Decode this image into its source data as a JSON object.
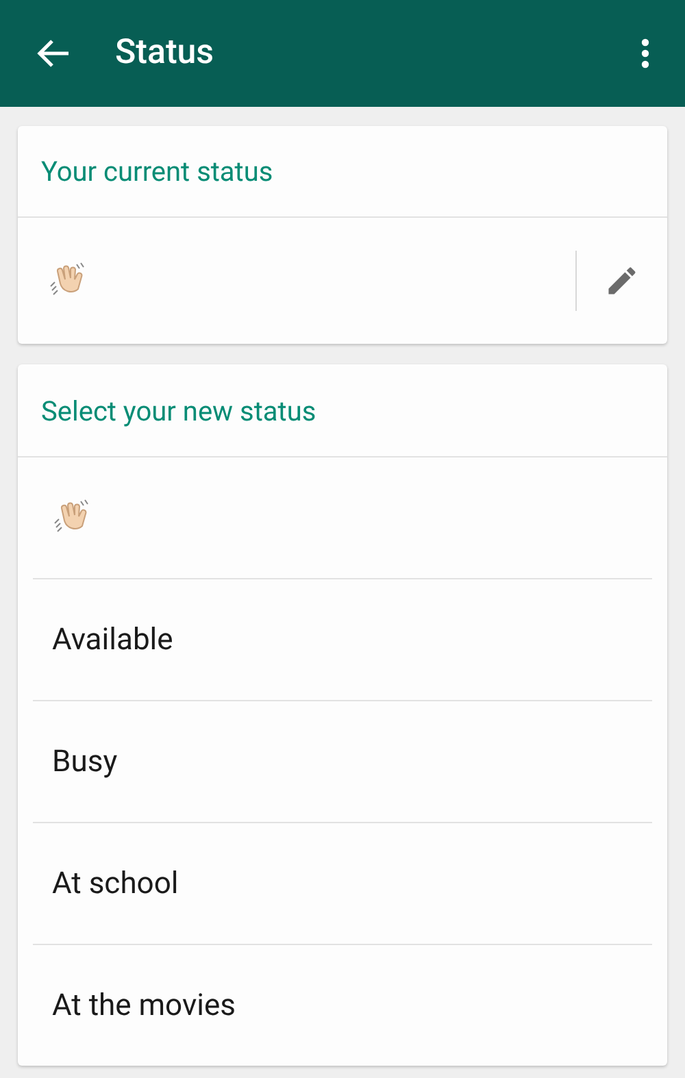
{
  "app_bar": {
    "title": "Status"
  },
  "current_status": {
    "heading": "Your current status",
    "value": {
      "kind": "wave"
    }
  },
  "new_status": {
    "heading": "Select your new status",
    "options": [
      {
        "kind": "wave"
      },
      {
        "kind": "text",
        "label": "Available"
      },
      {
        "kind": "text",
        "label": "Busy"
      },
      {
        "kind": "text",
        "label": "At school"
      },
      {
        "kind": "text",
        "label": "At the movies"
      }
    ]
  }
}
